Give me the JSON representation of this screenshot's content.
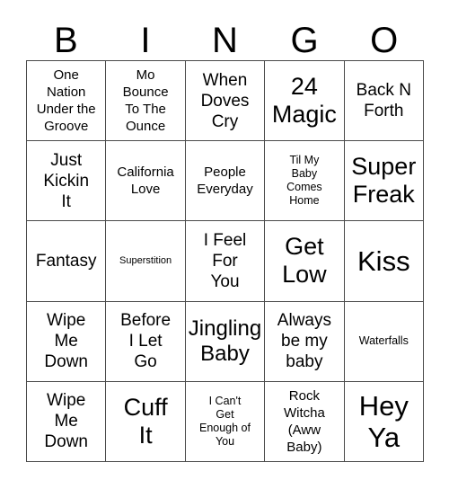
{
  "card": {
    "title": "BINGO",
    "header": {
      "letters": [
        "B",
        "I",
        "N",
        "G",
        "O"
      ]
    },
    "grid": {
      "columns": 5,
      "rows": 5,
      "border_color": "#4a4a4a",
      "background_color": "#ffffff",
      "text_color": "#000000"
    },
    "cells": [
      {
        "text": "One\nNation\nUnder the\nGroove",
        "size": "fs-md",
        "column": "B",
        "row": 1
      },
      {
        "text": "Mo\nBounce\nTo The\nOunce",
        "size": "fs-md",
        "column": "I",
        "row": 1
      },
      {
        "text": "When\nDoves\nCry",
        "size": "fs-lg",
        "column": "N",
        "row": 1
      },
      {
        "text": "24\nMagic",
        "size": "fs-2xl",
        "column": "G",
        "row": 1
      },
      {
        "text": "Back N\nForth",
        "size": "fs-lg",
        "column": "O",
        "row": 1
      },
      {
        "text": "Just\nKickin\nIt",
        "size": "fs-lg",
        "column": "B",
        "row": 2
      },
      {
        "text": "California\nLove",
        "size": "fs-md",
        "column": "I",
        "row": 2
      },
      {
        "text": "People\nEveryday",
        "size": "fs-md",
        "column": "N",
        "row": 2
      },
      {
        "text": "Til My\nBaby\nComes\nHome",
        "size": "fs-sm",
        "column": "G",
        "row": 2
      },
      {
        "text": "Super\nFreak",
        "size": "fs-2xl",
        "column": "O",
        "row": 2
      },
      {
        "text": "Fantasy",
        "size": "fs-lg",
        "column": "B",
        "row": 3
      },
      {
        "text": "Superstition",
        "size": "fs-xs",
        "column": "I",
        "row": 3
      },
      {
        "text": "I Feel\nFor\nYou",
        "size": "fs-lg",
        "column": "N",
        "row": 3
      },
      {
        "text": "Get\nLow",
        "size": "fs-2xl",
        "column": "G",
        "row": 3
      },
      {
        "text": "Kiss",
        "size": "fs-3xl",
        "column": "O",
        "row": 3
      },
      {
        "text": "Wipe\nMe\nDown",
        "size": "fs-lg",
        "column": "B",
        "row": 4
      },
      {
        "text": "Before\nI Let\nGo",
        "size": "fs-lg",
        "column": "I",
        "row": 4
      },
      {
        "text": "Jingling\nBaby",
        "size": "fs-xl",
        "column": "N",
        "row": 4
      },
      {
        "text": "Always\nbe my\nbaby",
        "size": "fs-lg",
        "column": "G",
        "row": 4
      },
      {
        "text": "Waterfalls",
        "size": "fs-sm",
        "column": "O",
        "row": 4
      },
      {
        "text": "Wipe\nMe\nDown",
        "size": "fs-lg",
        "column": "B",
        "row": 5
      },
      {
        "text": "Cuff\nIt",
        "size": "fs-2xl",
        "column": "I",
        "row": 5
      },
      {
        "text": "I Can't\nGet\nEnough of\nYou",
        "size": "fs-sm",
        "column": "N",
        "row": 5
      },
      {
        "text": "Rock\nWitcha\n(Aww\nBaby)",
        "size": "fs-md",
        "column": "G",
        "row": 5
      },
      {
        "text": "Hey\nYa",
        "size": "fs-3xl",
        "column": "O",
        "row": 5
      }
    ]
  }
}
